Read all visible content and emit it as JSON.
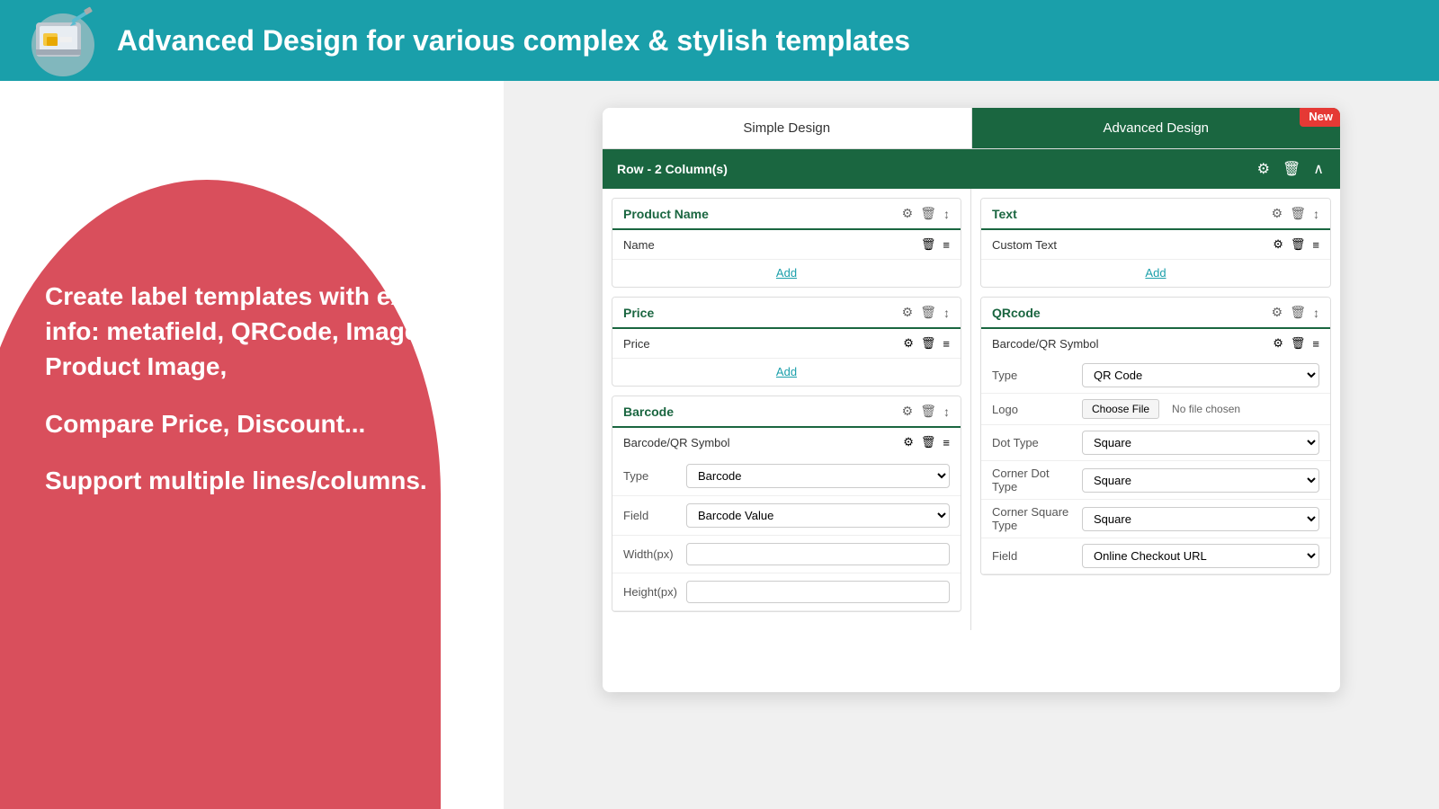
{
  "banner": {
    "title": "Advanced Design for various complex & stylish templates"
  },
  "left": {
    "paragraph1": "Create label templates with extra info: metafield, QRCode, Image, Product Image,",
    "paragraph2": "Compare Price, Discount...",
    "paragraph3": "Support multiple lines/columns."
  },
  "tabs": {
    "simple": "Simple Design",
    "advanced": "Advanced Design",
    "new_badge": "New"
  },
  "row_header": {
    "label": "Row - 2 Column(s)"
  },
  "left_col": {
    "product_name": {
      "title": "Product Name",
      "row_label": "Name",
      "add_label": "Add"
    },
    "price": {
      "title": "Price",
      "row_label": "Price",
      "add_label": "Add"
    },
    "barcode": {
      "title": "Barcode",
      "row_label": "Barcode/QR Symbol",
      "type_label": "Type",
      "type_value": "Barcode",
      "field_label": "Field",
      "field_value": "Barcode Value",
      "width_label": "Width(px)",
      "height_label": "Height(px)"
    }
  },
  "right_col": {
    "text": {
      "title": "Text",
      "row_label": "Custom Text",
      "add_label": "Add"
    },
    "qrcode": {
      "title": "QRcode",
      "row_label": "Barcode/QR Symbol",
      "type_label": "Type",
      "type_value": "QR Code",
      "logo_label": "Logo",
      "choose_file": "Choose File",
      "no_file": "No file chosen",
      "dot_type_label": "Dot Type",
      "dot_type_value": "Square",
      "corner_dot_label": "Corner Dot Type",
      "corner_dot_value": "Square",
      "corner_square_label": "Corner Square Type",
      "corner_square_value": "Square",
      "field_label": "Field",
      "field_value": "Online Checkout URL"
    }
  }
}
